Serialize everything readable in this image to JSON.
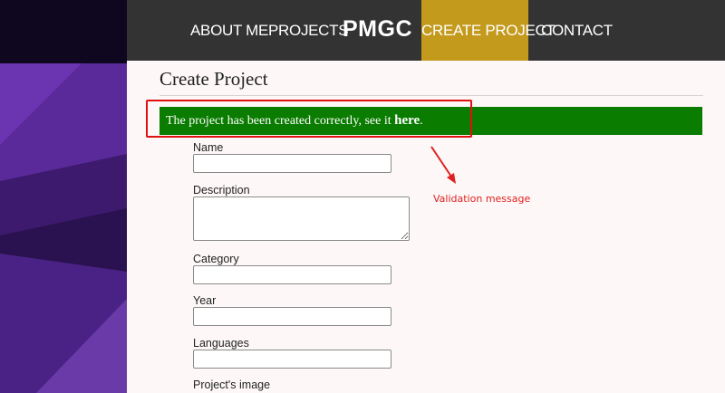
{
  "nav": {
    "items": [
      {
        "label": "ABOUT ME"
      },
      {
        "label": "PROJECTS"
      },
      {
        "label": "CREATE PROJECT"
      },
      {
        "label": "CONTACT"
      }
    ],
    "brand": "PMGC",
    "active_color": "#c49a1c",
    "bar_color": "#333333"
  },
  "page": {
    "title": "Create Project"
  },
  "alert": {
    "message": "The project has been created correctly, see it ",
    "link_text": "here",
    "suffix": ".",
    "color": "#0a7c00"
  },
  "annotation": {
    "text": "Validation message",
    "color": "#e02020"
  },
  "form": {
    "fields": [
      {
        "label": "Name",
        "value": ""
      },
      {
        "label": "Description",
        "value": ""
      },
      {
        "label": "Category",
        "value": ""
      },
      {
        "label": "Year",
        "value": ""
      },
      {
        "label": "Languages",
        "value": ""
      },
      {
        "label": "Project's image"
      }
    ]
  }
}
